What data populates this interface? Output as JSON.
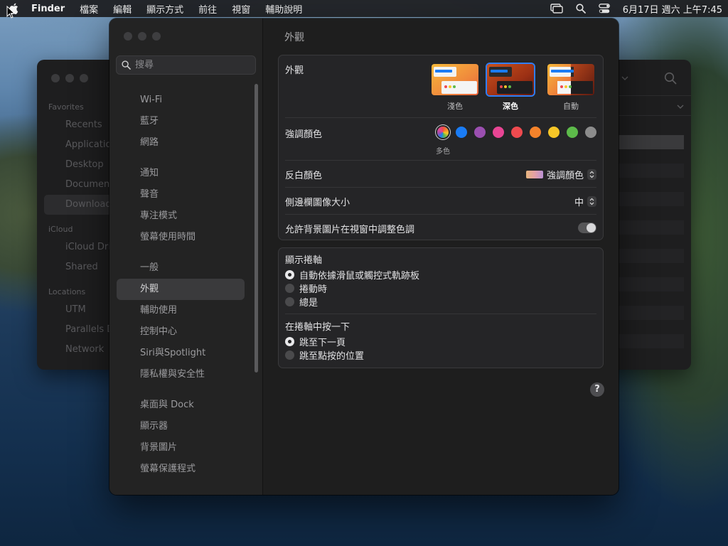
{
  "menubar": {
    "app_name": "Finder",
    "menus": [
      "檔案",
      "編輯",
      "顯示方式",
      "前往",
      "視窗",
      "輔助說明"
    ],
    "clock": "6月17日 週六 上午7:45",
    "icons": [
      "apple-logo-icon",
      "screen-mirroring-icon",
      "spotlight-search-icon",
      "control-center-icon"
    ]
  },
  "finder": {
    "sections": [
      {
        "title": "Favorites",
        "items": [
          "Recents",
          "Applications",
          "Desktop",
          "Documents",
          "Downloads"
        ]
      },
      {
        "title": "iCloud",
        "items": [
          "iCloud Drive",
          "Shared"
        ]
      },
      {
        "title": "Locations",
        "items": [
          "UTM",
          "Parallels D",
          "Network"
        ]
      }
    ],
    "selected": "Downloads"
  },
  "settings": {
    "search": {
      "placeholder": "搜尋"
    },
    "nav_groups": [
      [
        "Wi-Fi",
        "藍牙",
        "網路"
      ],
      [
        "通知",
        "聲音",
        "專注模式",
        "螢幕使用時間"
      ],
      [
        "一般",
        "外觀",
        "輔助使用",
        "控制中心",
        "Siri與Spotlight",
        "隱私權與安全性"
      ],
      [
        "桌面與 Dock",
        "顯示器",
        "背景圖片",
        "螢幕保護程式"
      ]
    ],
    "selected_nav": "外觀",
    "page_title": "外觀",
    "appearance": {
      "label": "外觀",
      "options": [
        "淺色",
        "深色",
        "自動"
      ],
      "selected": "深色"
    },
    "accent": {
      "label": "強調顏色",
      "selected_label": "多色",
      "colors": [
        "multicolor",
        "#1a7cf5",
        "#9b4fb0",
        "#e84594",
        "#ef4a4f",
        "#f5832b",
        "#f7c627",
        "#5dbb4a",
        "#8c8c8c"
      ]
    },
    "highlight": {
      "label": "反白顏色",
      "value": "強調顏色"
    },
    "sidebar_icon_size": {
      "label": "側邊欄圖像大小",
      "value": "中"
    },
    "wallpaper_tint": {
      "label": "允許背景圖片在視窗中調整色調",
      "enabled": true
    },
    "scrollbars": {
      "title": "顯示捲軸",
      "options": [
        "自動依據滑鼠或觸控式軌跡板",
        "捲動時",
        "總是"
      ],
      "selected": 0
    },
    "click_scrollbar": {
      "title": "在捲軸中按一下",
      "options": [
        "跳至下一頁",
        "跳至點按的位置"
      ],
      "selected": 0
    },
    "help_label": "?"
  }
}
